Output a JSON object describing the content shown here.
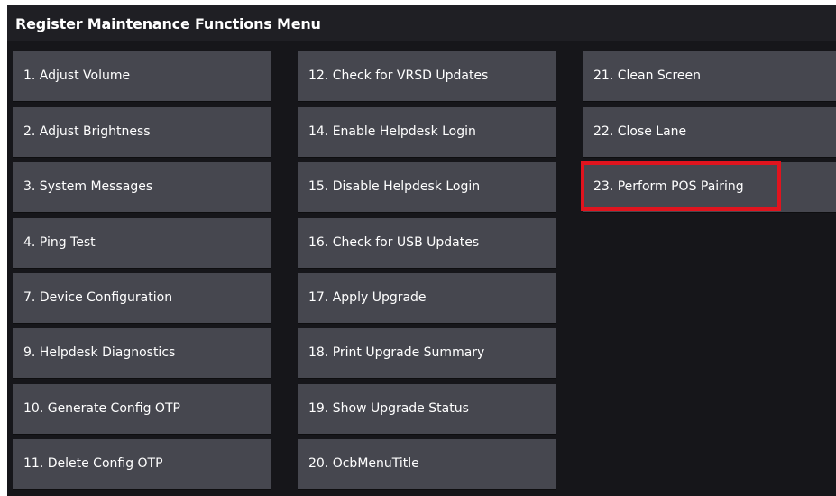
{
  "menu": {
    "title": "Register Maintenance Functions Menu",
    "columns": [
      [
        "1. Adjust Volume",
        "2. Adjust Brightness",
        "3. System Messages",
        "4. Ping Test",
        "7. Device Configuration",
        "9. Helpdesk Diagnostics",
        "10. Generate Config OTP",
        "11. Delete Config OTP"
      ],
      [
        "12. Check for VRSD Updates",
        "14. Enable Helpdesk Login",
        "15. Disable Helpdesk Login",
        "16. Check for USB Updates",
        "17. Apply Upgrade",
        "18. Print Upgrade Summary",
        "19. Show Upgrade Status",
        "20. OcbMenuTitle"
      ],
      [
        "21. Clean Screen",
        "22. Close Lane",
        "23. Perform POS Pairing"
      ]
    ]
  },
  "colors": {
    "background": "#16161a",
    "title_bar": "#1f1f24",
    "button": "#46474f",
    "text": "#ffffff",
    "highlight": "#e0141e"
  },
  "highlighted_item": "23. Perform POS Pairing"
}
